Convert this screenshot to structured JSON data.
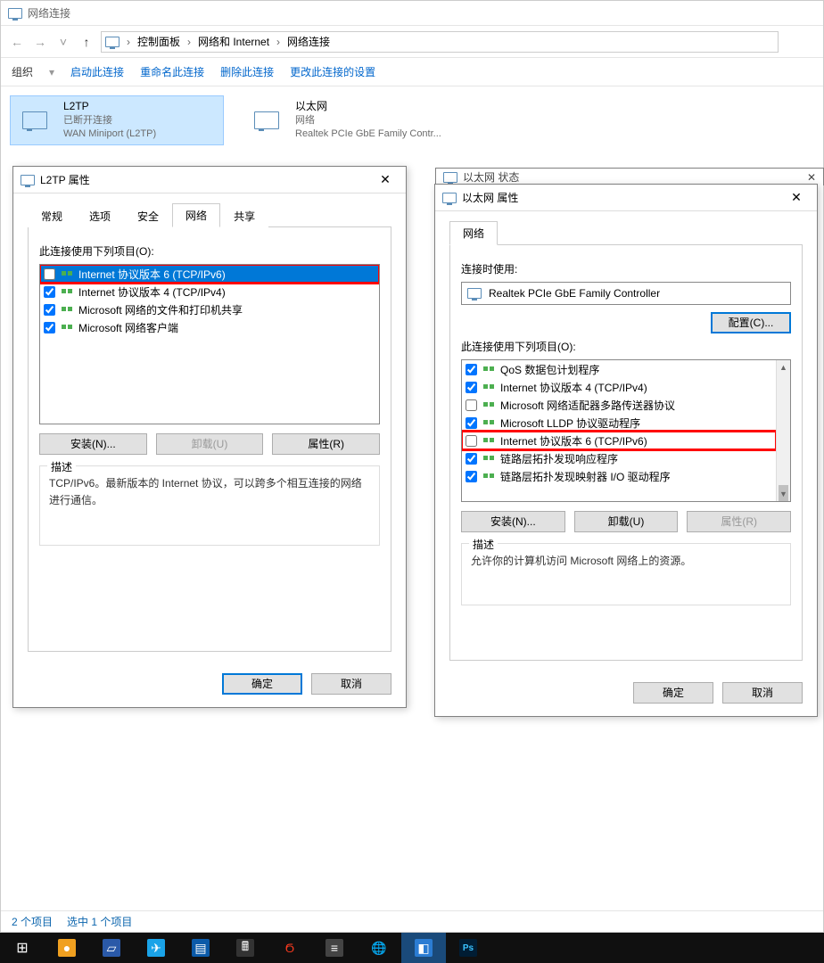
{
  "explorer": {
    "title": "网络连接",
    "breadcrumbs": [
      "控制面板",
      "网络和 Internet",
      "网络连接"
    ],
    "toolbar": {
      "organize": "组织",
      "start": "启动此连接",
      "rename": "重命名此连接",
      "delete": "删除此连接",
      "change": "更改此连接的设置"
    },
    "connections": [
      {
        "name": "L2TP",
        "status": "已断开连接",
        "device": "WAN Miniport (L2TP)",
        "selected": true
      },
      {
        "name": "以太网",
        "status": "网络",
        "device": "Realtek PCIe GbE Family Contr...",
        "selected": false
      }
    ],
    "statusbar": {
      "items_count": "2 个项目",
      "selected_count": "选中 1 个项目"
    }
  },
  "dlg_behind": {
    "title_fragment": "以太网 状态",
    "close": "✕"
  },
  "dlg_l2tp": {
    "title": "L2TP 属性",
    "tabs": [
      "常规",
      "选项",
      "安全",
      "网络",
      "共享"
    ],
    "active_tab": 3,
    "items_label": "此连接使用下列项目(O):",
    "items": [
      {
        "label": "Internet 协议版本 6 (TCP/IPv6)",
        "checked": false,
        "selected": true,
        "highlight": true
      },
      {
        "label": "Internet 协议版本 4 (TCP/IPv4)",
        "checked": true
      },
      {
        "label": "Microsoft 网络的文件和打印机共享",
        "checked": true
      },
      {
        "label": "Microsoft 网络客户端",
        "checked": true
      }
    ],
    "buttons": {
      "install": "安装(N)...",
      "uninstall": "卸载(U)",
      "properties": "属性(R)"
    },
    "desc_legend": "描述",
    "desc_text": "TCP/IPv6。最新版本的 Internet 协议，可以跨多个相互连接的网络进行通信。",
    "ok": "确定",
    "cancel": "取消"
  },
  "dlg_eth": {
    "title": "以太网 属性",
    "tabs": [
      "网络"
    ],
    "connect_using": "连接时使用:",
    "adapter": "Realtek PCIe GbE Family Controller",
    "configure": "配置(C)...",
    "items_label": "此连接使用下列项目(O):",
    "items": [
      {
        "label": "QoS 数据包计划程序",
        "checked": true,
        "icon": "qos"
      },
      {
        "label": "Internet 协议版本 4 (TCP/IPv4)",
        "checked": true
      },
      {
        "label": "Microsoft 网络适配器多路传送器协议",
        "checked": false
      },
      {
        "label": "Microsoft LLDP 协议驱动程序",
        "checked": true
      },
      {
        "label": "Internet 协议版本 6 (TCP/IPv6)",
        "checked": false,
        "highlight": true
      },
      {
        "label": "链路层拓扑发现响应程序",
        "checked": true
      },
      {
        "label": "链路层拓扑发现映射器 I/O 驱动程序",
        "checked": true
      }
    ],
    "buttons": {
      "install": "安装(N)...",
      "uninstall": "卸载(U)",
      "properties": "属性(R)"
    },
    "desc_legend": "描述",
    "desc_text": "允许你的计算机访问 Microsoft 网络上的资源。",
    "ok": "确定",
    "cancel": "取消"
  },
  "close_glyph": "✕"
}
